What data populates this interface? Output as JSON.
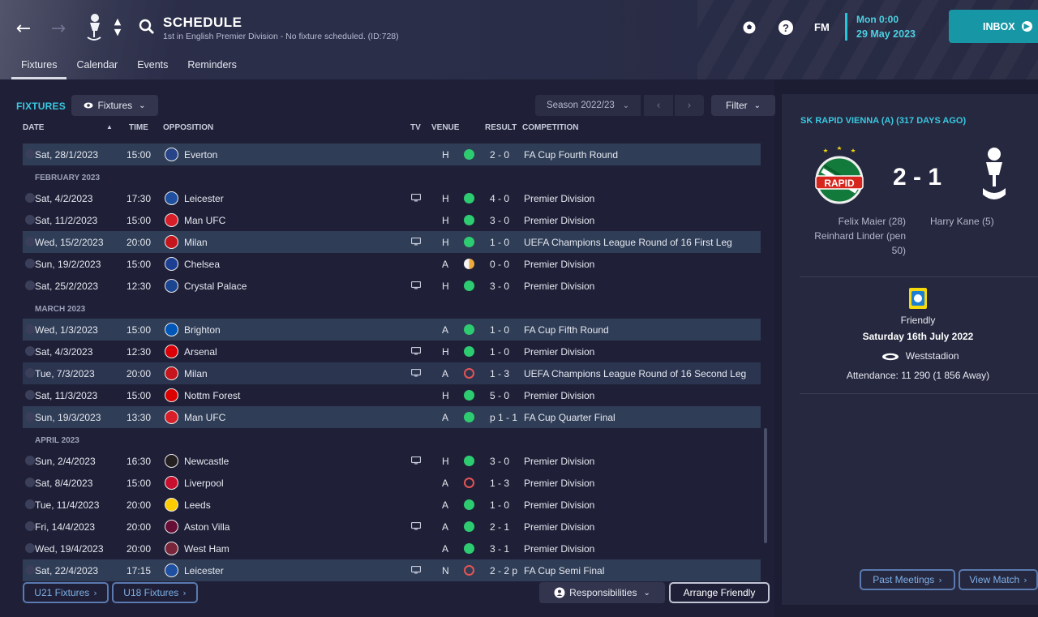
{
  "header": {
    "title": "SCHEDULE",
    "subtitle": "1st in English Premier Division - No fixture scheduled. (ID:728)",
    "fm_logo": "FM",
    "date_line1": "Mon 0:00",
    "date_line2": "29 May 2023",
    "inbox_label": "INBOX"
  },
  "tabs": [
    "Fixtures",
    "Calendar",
    "Events",
    "Reminders"
  ],
  "fixtures": {
    "title": "FIXTURES",
    "view_dropdown": "Fixtures",
    "season": "Season 2022/23",
    "filter_label": "Filter",
    "columns": {
      "date": "DATE",
      "time": "TIME",
      "opposition": "OPPOSITION",
      "tv": "TV",
      "venue": "VENUE",
      "result": "RESULT",
      "competition": "COMPETITION"
    },
    "months": {
      "feb": "FEBRUARY 2023",
      "mar": "MARCH 2023",
      "apr": "APRIL 2023"
    },
    "rows": [
      {
        "date": "Sat, 28/1/2023",
        "time": "15:00",
        "opp": "Everton",
        "tv": false,
        "venue": "H",
        "result": "win",
        "score": "2 - 0",
        "comp": "FA Cup Fourth Round",
        "badge": "#274488"
      },
      {
        "date": "Sat, 4/2/2023",
        "time": "17:30",
        "opp": "Leicester",
        "tv": true,
        "venue": "H",
        "result": "win",
        "score": "4 - 0",
        "comp": "Premier Division",
        "badge": "#1e4fa0"
      },
      {
        "date": "Sat, 11/2/2023",
        "time": "15:00",
        "opp": "Man UFC",
        "tv": false,
        "venue": "H",
        "result": "win",
        "score": "3 - 0",
        "comp": "Premier Division",
        "badge": "#d81e28"
      },
      {
        "date": "Wed, 15/2/2023",
        "time": "20:00",
        "opp": "Milan",
        "tv": true,
        "venue": "H",
        "result": "win",
        "score": "1 - 0",
        "comp": "UEFA Champions League Round of 16  First Leg",
        "badge": "#c4161c"
      },
      {
        "date": "Sun, 19/2/2023",
        "time": "15:00",
        "opp": "Chelsea",
        "tv": false,
        "venue": "A",
        "result": "draw",
        "score": "0 - 0",
        "comp": "Premier Division",
        "badge": "#1c3f94"
      },
      {
        "date": "Sat, 25/2/2023",
        "time": "12:30",
        "opp": "Crystal Palace",
        "tv": true,
        "venue": "H",
        "result": "win",
        "score": "3 - 0",
        "comp": "Premier Division",
        "badge": "#1b458f"
      },
      {
        "date": "Wed, 1/3/2023",
        "time": "15:00",
        "opp": "Brighton",
        "tv": false,
        "venue": "A",
        "result": "win",
        "score": "1 - 0",
        "comp": "FA Cup Fifth Round",
        "badge": "#0057b8"
      },
      {
        "date": "Sat, 4/3/2023",
        "time": "12:30",
        "opp": "Arsenal",
        "tv": true,
        "venue": "H",
        "result": "win",
        "score": "1 - 0",
        "comp": "Premier Division",
        "badge": "#db0007"
      },
      {
        "date": "Tue, 7/3/2023",
        "time": "20:00",
        "opp": "Milan",
        "tv": true,
        "venue": "A",
        "result": "loss",
        "score": "1 - 3",
        "comp": "UEFA Champions League Round of 16  Second Leg",
        "badge": "#c4161c"
      },
      {
        "date": "Sat, 11/3/2023",
        "time": "15:00",
        "opp": "Nottm Forest",
        "tv": false,
        "venue": "H",
        "result": "win",
        "score": "5 - 0",
        "comp": "Premier Division",
        "badge": "#dd0000"
      },
      {
        "date": "Sun, 19/3/2023",
        "time": "13:30",
        "opp": "Man UFC",
        "tv": false,
        "venue": "A",
        "result": "win",
        "score": "p 1 - 1",
        "comp": "FA Cup Quarter Final",
        "badge": "#d81e28"
      },
      {
        "date": "Sun, 2/4/2023",
        "time": "16:30",
        "opp": "Newcastle",
        "tv": true,
        "venue": "H",
        "result": "win",
        "score": "3 - 0",
        "comp": "Premier Division",
        "badge": "#241f20"
      },
      {
        "date": "Sat, 8/4/2023",
        "time": "15:00",
        "opp": "Liverpool",
        "tv": false,
        "venue": "A",
        "result": "loss",
        "score": "1 - 3",
        "comp": "Premier Division",
        "badge": "#c8102e"
      },
      {
        "date": "Tue, 11/4/2023",
        "time": "20:00",
        "opp": "Leeds",
        "tv": false,
        "venue": "A",
        "result": "win",
        "score": "1 - 0",
        "comp": "Premier Division",
        "badge": "#ffcd00"
      },
      {
        "date": "Fri, 14/4/2023",
        "time": "20:00",
        "opp": "Aston Villa",
        "tv": true,
        "venue": "A",
        "result": "win",
        "score": "2 - 1",
        "comp": "Premier Division",
        "badge": "#670e36"
      },
      {
        "date": "Wed, 19/4/2023",
        "time": "20:00",
        "opp": "West Ham",
        "tv": false,
        "venue": "A",
        "result": "win",
        "score": "3 - 1",
        "comp": "Premier Division",
        "badge": "#7a263a"
      },
      {
        "date": "Sat, 22/4/2023",
        "time": "17:15",
        "opp": "Leicester",
        "tv": true,
        "venue": "N",
        "result": "loss",
        "score": "2 - 2 p",
        "comp": "FA Cup Semi Final",
        "badge": "#1e4fa0"
      }
    ],
    "u21_label": "U21 Fixtures",
    "u18_label": "U18 Fixtures",
    "responsibilities_label": "Responsibilities",
    "arrange_label": "Arrange Friendly"
  },
  "match_panel": {
    "title": "SK RAPID VIENNA (A) (317 DAYS AGO)",
    "score": "2 - 1",
    "home_scorers": [
      "Felix Maier (28)",
      "Reinhard Linder (pen",
      "50)"
    ],
    "away_scorers": [
      "Harry Kane (5)"
    ],
    "home_crest_text": "RAPID",
    "competition": "Friendly",
    "date": "Saturday 16th July 2022",
    "venue": "Weststadion",
    "attendance": "Attendance: 11 290 (1 856 Away)",
    "past_meetings_label": "Past Meetings",
    "view_match_label": "View Match"
  },
  "colors": {
    "win": "#2ecc71",
    "draw": "#f0a93b",
    "loss": "#e45454",
    "accent": "#39c8e0",
    "inbox": "#1797a6"
  }
}
